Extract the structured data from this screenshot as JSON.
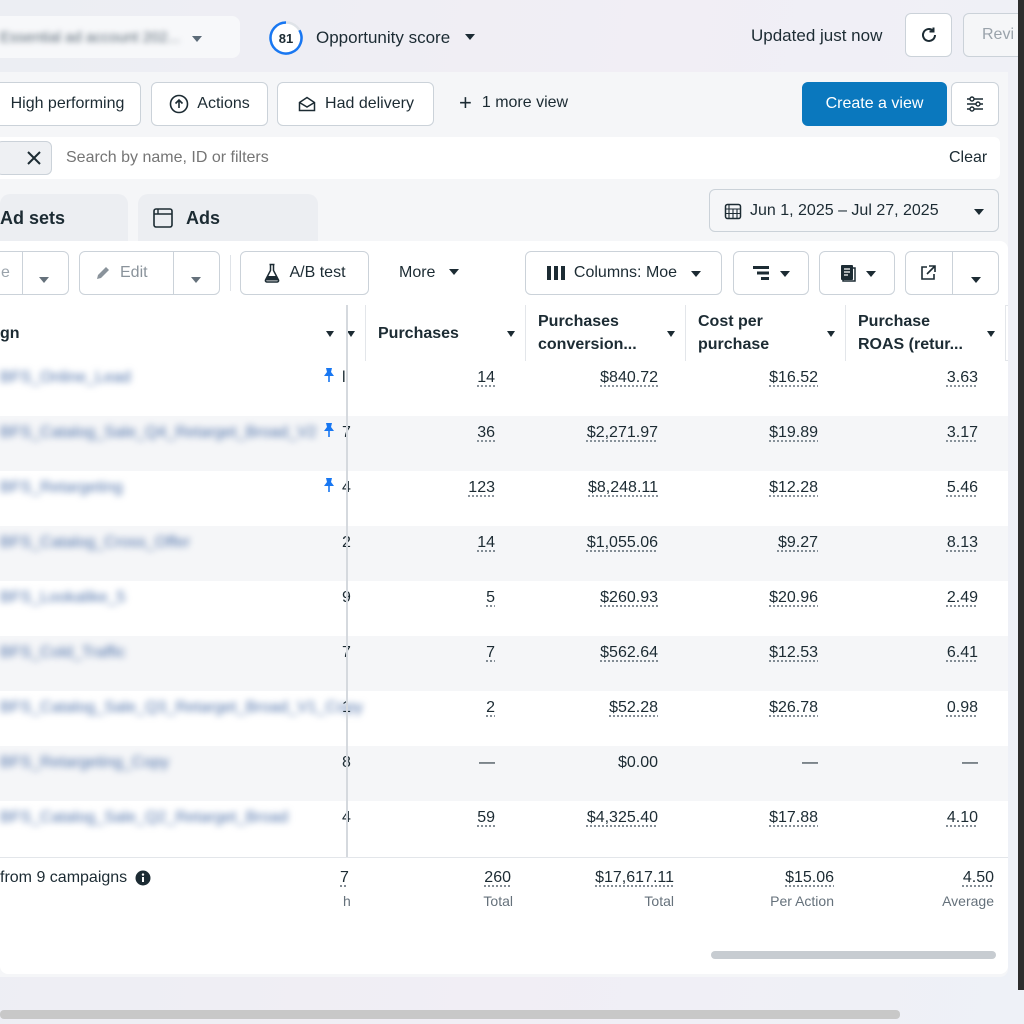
{
  "topbar": {
    "account_name": "Essential ad account 202...",
    "score_value": "81",
    "score_label": "Opportunity score",
    "updated_text": "Updated just now",
    "review_label": "Revi"
  },
  "views": {
    "high_performing": "High performing",
    "actions": "Actions",
    "had_delivery": "Had delivery",
    "more_view": "1 more view",
    "create_view": "Create a view"
  },
  "search": {
    "placeholder": "Search by name, ID or filters",
    "clear": "Clear"
  },
  "tabs": {
    "ad_sets": "Ad sets",
    "ads": "Ads"
  },
  "date_range": "Jun 1, 2025 – Jul 27, 2025",
  "toolbar": {
    "dup_label": "e",
    "edit": "Edit",
    "ab_test": "A/B test",
    "more": "More",
    "columns": "Columns: Moe"
  },
  "table": {
    "headers": {
      "campaign": "gn",
      "purchases": "Purchases",
      "conv_value_1": "Purchases",
      "conv_value_2": "conversion...",
      "cpp_1": "Cost per",
      "cpp_2": "purchase",
      "roas_1": "Purchase",
      "roas_2": "ROAS (retur..."
    },
    "rows": [
      {
        "name": "BFS_Online_Lead",
        "cut": "l",
        "purchases": "14",
        "value": "$840.72",
        "cpp": "$16.52",
        "roas": "3.63",
        "pinned": true
      },
      {
        "name": "BFS_Catalog_Sale_Q4_Retarget_Broad_V2",
        "cut": "7",
        "purchases": "36",
        "value": "$2,271.97",
        "cpp": "$19.89",
        "roas": "3.17",
        "pinned": true
      },
      {
        "name": "BFS_Retargeting",
        "cut": "4",
        "purchases": "123",
        "value": "$8,248.11",
        "cpp": "$12.28",
        "roas": "5.46",
        "pinned": true
      },
      {
        "name": "BFS_Catalog_Cross_Offer",
        "cut": "2",
        "purchases": "14",
        "value": "$1,055.06",
        "cpp": "$9.27",
        "roas": "8.13",
        "pinned": false
      },
      {
        "name": "BFS_Lookalike_5",
        "cut": "9",
        "purchases": "5",
        "value": "$260.93",
        "cpp": "$20.96",
        "roas": "2.49",
        "pinned": false
      },
      {
        "name": "BFS_Cold_Traffic",
        "cut": "7",
        "purchases": "7",
        "value": "$562.64",
        "cpp": "$12.53",
        "roas": "6.41",
        "pinned": false
      },
      {
        "name": "BFS_Catalog_Sale_Q3_Retarget_Broad_V1_Copy",
        "cut": "1",
        "purchases": "2",
        "value": "$52.28",
        "cpp": "$26.78",
        "roas": "0.98",
        "pinned": false
      },
      {
        "name": "BFS_Retargeting_Copy",
        "cut": "8",
        "purchases": "—",
        "value": "$0.00",
        "cpp": "—",
        "roas": "—",
        "pinned": false
      },
      {
        "name": "BFS_Catalog_Sale_Q2_Retarget_Broad",
        "cut": "4",
        "purchases": "59",
        "value": "$4,325.40",
        "cpp": "$17.88",
        "roas": "4.10",
        "pinned": false
      }
    ],
    "totals": {
      "label": "from 9 campaigns",
      "cut": "7",
      "cut_sub": "h",
      "purchases": "260",
      "purchases_sub": "Total",
      "value": "$17,617.11",
      "value_sub": "Total",
      "cpp": "$15.06",
      "cpp_sub": "Per Action",
      "roas": "4.50",
      "roas_sub": "Average"
    }
  },
  "colors": {
    "primary": "#0a78be",
    "accent_blue": "#1877f2",
    "border": "#cbd2d9"
  }
}
